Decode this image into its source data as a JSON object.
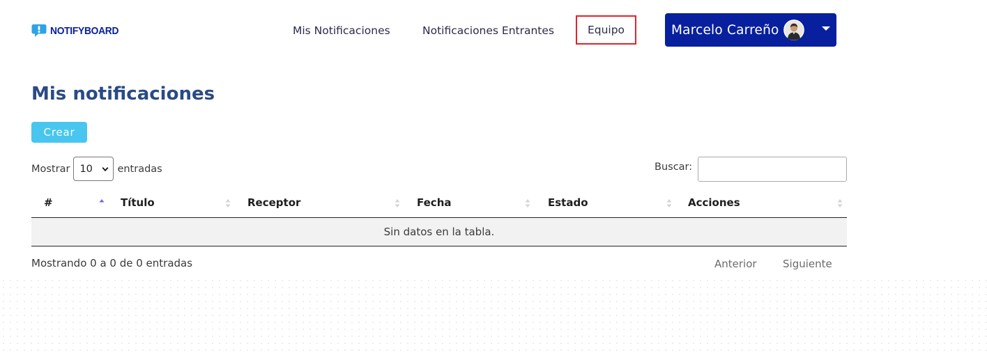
{
  "app": {
    "brand_name": "NOTIFYBOARD",
    "brand_color": "#08209e"
  },
  "nav": {
    "links": [
      {
        "label": "Mis Notificaciones"
      },
      {
        "label": "Notificaciones Entrantes"
      },
      {
        "label": "Equipo",
        "highlighted": true,
        "highlight_color": "#e0232b"
      }
    ],
    "user": {
      "name": "Marcelo Carreño",
      "avatar_icon": "user-avatar-icon",
      "dropdown_icon": "caret-down-icon"
    }
  },
  "main": {
    "title": "Mis notificaciones",
    "create_button": {
      "label": "Crear",
      "color": "#48c6f0"
    }
  },
  "table_controls": {
    "length": {
      "prefix": "Mostrar",
      "selected": "10",
      "suffix": "entradas"
    },
    "search": {
      "label": "Buscar:",
      "value": "",
      "placeholder": ""
    }
  },
  "table": {
    "columns": [
      {
        "label": "#",
        "sort": "asc"
      },
      {
        "label": "Título",
        "sort": "none"
      },
      {
        "label": "Receptor",
        "sort": "none"
      },
      {
        "label": "Fecha",
        "sort": "none"
      },
      {
        "label": "Estado",
        "sort": "none"
      },
      {
        "label": "Acciones",
        "sort": "none"
      }
    ],
    "rows": [],
    "empty_message": "Sin datos en la tabla."
  },
  "pagination": {
    "info": "Mostrando 0 a 0 de 0 entradas",
    "previous_label": "Anterior",
    "next_label": "Siguiente"
  }
}
